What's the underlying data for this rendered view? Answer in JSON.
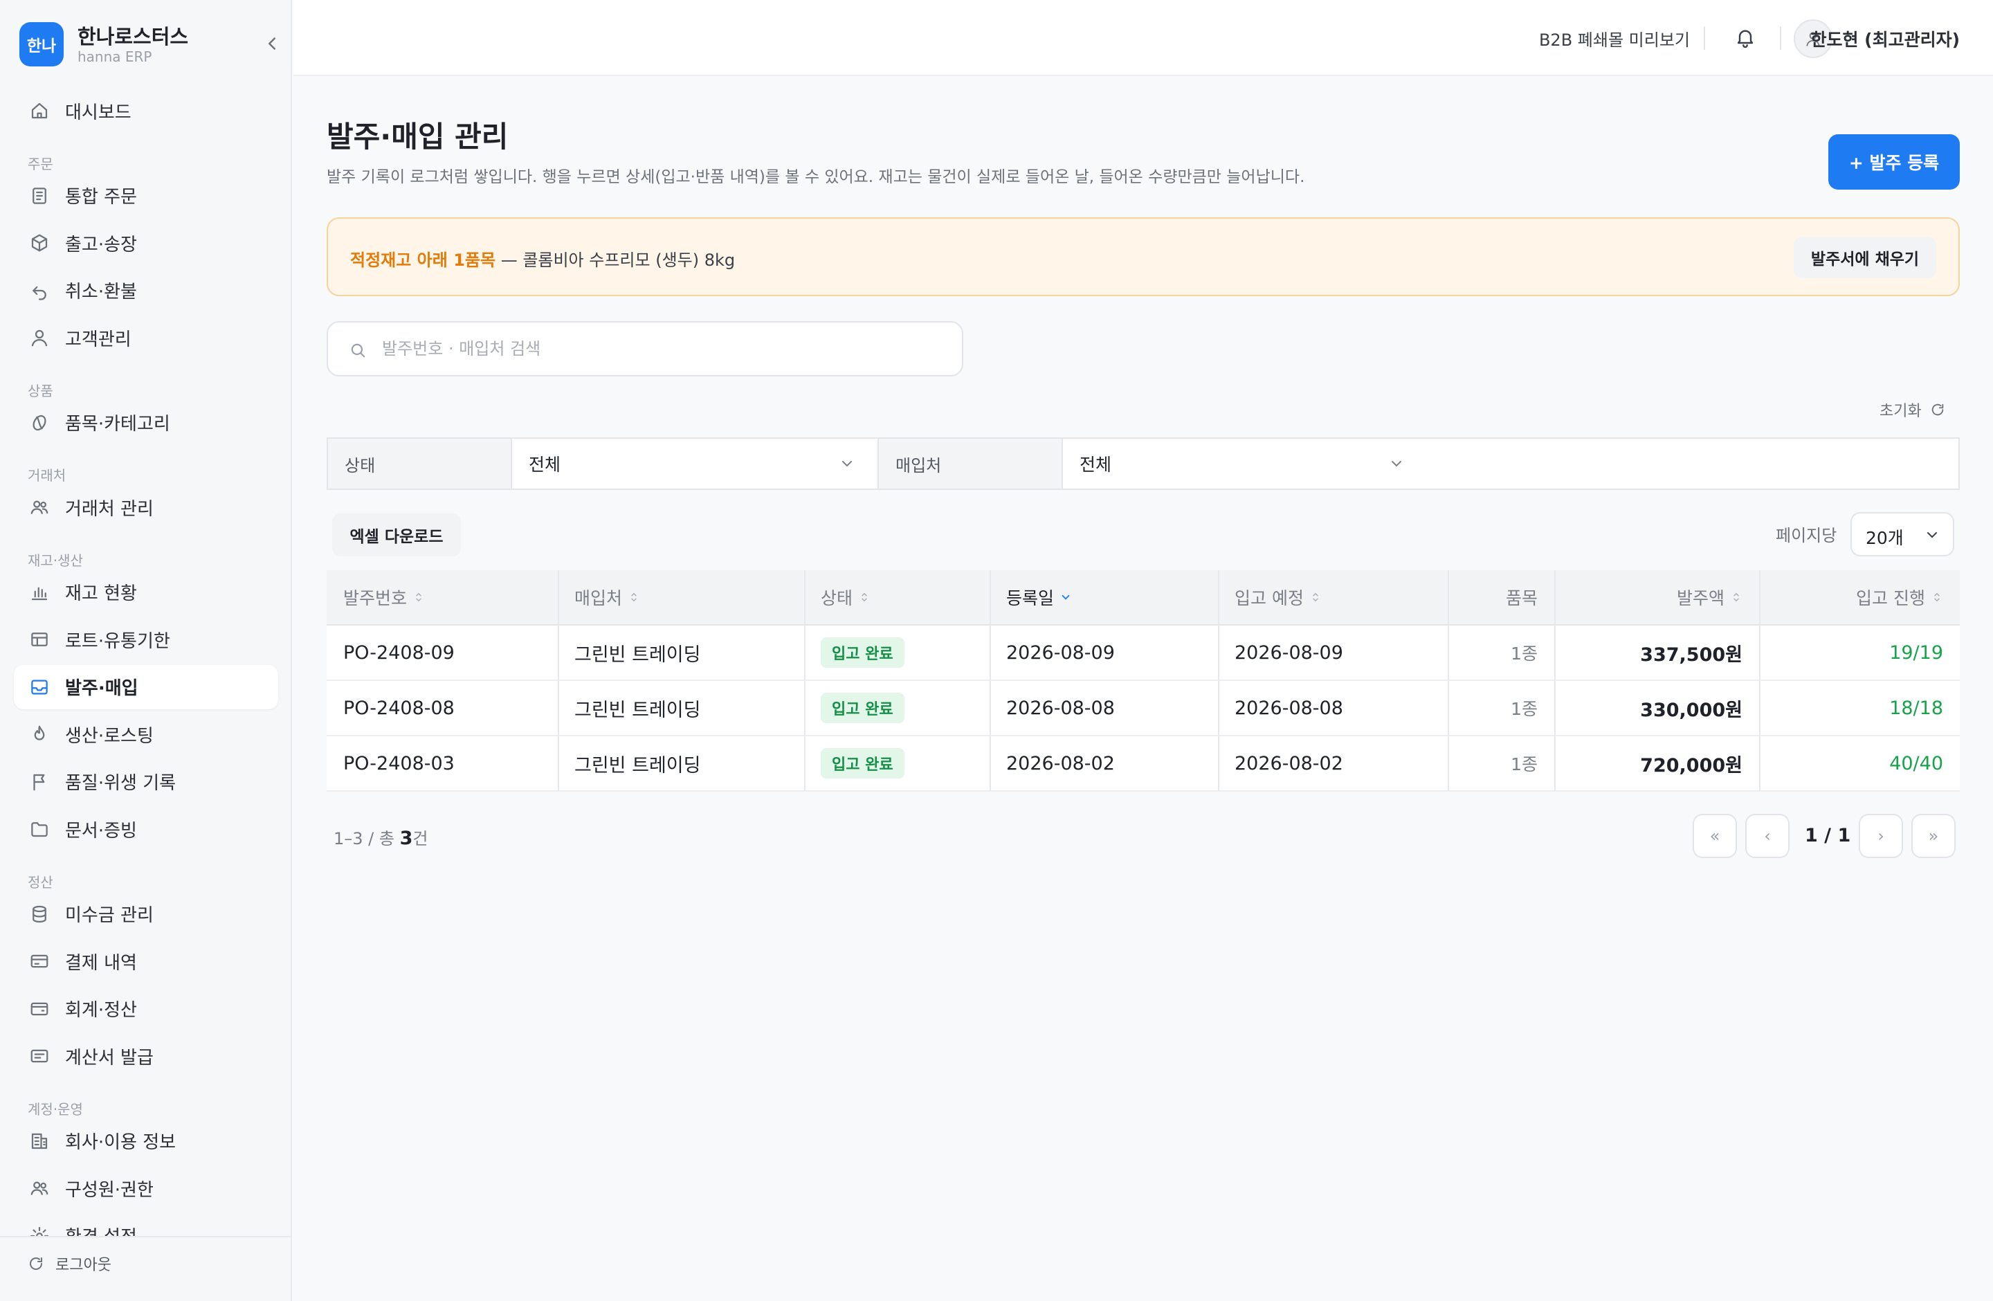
{
  "brand": {
    "logo_text": "한나",
    "name": "한나로스터스",
    "subtitle": "hanna ERP"
  },
  "sidebar": {
    "items": [
      {
        "type": "item",
        "label": "대시보드",
        "icon": "home-icon"
      },
      {
        "type": "group",
        "label": "주문"
      },
      {
        "type": "item",
        "label": "통합 주문",
        "icon": "document-icon"
      },
      {
        "type": "item",
        "label": "출고·송장",
        "icon": "box-icon"
      },
      {
        "type": "item",
        "label": "취소·환불",
        "icon": "undo-icon"
      },
      {
        "type": "item",
        "label": "고객관리",
        "icon": "user-icon"
      },
      {
        "type": "group",
        "label": "상품"
      },
      {
        "type": "item",
        "label": "품목·카테고리",
        "icon": "bean-icon"
      },
      {
        "type": "group",
        "label": "거래처"
      },
      {
        "type": "item",
        "label": "거래처 관리",
        "icon": "users-icon"
      },
      {
        "type": "group",
        "label": "재고·생산"
      },
      {
        "type": "item",
        "label": "재고 현황",
        "icon": "bar-chart-icon"
      },
      {
        "type": "item",
        "label": "로트·유통기한",
        "icon": "table-icon"
      },
      {
        "type": "item",
        "label": "발주·매입",
        "icon": "inbox-icon",
        "active": true
      },
      {
        "type": "item",
        "label": "생산·로스팅",
        "icon": "flame-icon"
      },
      {
        "type": "item",
        "label": "품질·위생 기록",
        "icon": "flag-icon"
      },
      {
        "type": "item",
        "label": "문서·증빙",
        "icon": "folder-icon"
      },
      {
        "type": "group",
        "label": "정산"
      },
      {
        "type": "item",
        "label": "미수금 관리",
        "icon": "database-icon"
      },
      {
        "type": "item",
        "label": "결제 내역",
        "icon": "card-icon"
      },
      {
        "type": "item",
        "label": "회계·정산",
        "icon": "wallet-icon"
      },
      {
        "type": "item",
        "label": "계산서 발급",
        "icon": "receipt-icon"
      },
      {
        "type": "group",
        "label": "계정·운영"
      },
      {
        "type": "item",
        "label": "회사·이용 정보",
        "icon": "building-icon"
      },
      {
        "type": "item",
        "label": "구성원·권한",
        "icon": "users-icon"
      },
      {
        "type": "item",
        "label": "환경 설정",
        "icon": "gear-icon"
      }
    ],
    "logout_label": "로그아웃"
  },
  "header": {
    "preview_label": "B2B 폐쇄몰 미리보기",
    "user_name": "한도현 (최고관리자)"
  },
  "page": {
    "title": "발주·매입 관리",
    "description": "발주 기록이 로그처럼 쌓입니다. 행을 누르면 상세(입고·반품 내역)를 볼 수 있어요. 재고는 물건이 실제로 들어온 날, 들어온 수량만큼만 늘어납니다.",
    "add_button": "+ 발주 등록"
  },
  "alert": {
    "strong": "적정재고 아래 1품목",
    "text": " — 콜롬비아 수프리모 (생두) 8kg",
    "button": "발주서에 채우기"
  },
  "search": {
    "placeholder": "발주번호 · 매입처 검색"
  },
  "filters": {
    "reset_label": "초기화",
    "status_label": "상태",
    "status_value": "전체",
    "vendor_label": "매입처",
    "vendor_value": "전체"
  },
  "toolbar": {
    "excel_label": "엑셀 다운로드",
    "per_page_label": "페이지당",
    "per_page_value": "20개"
  },
  "table": {
    "columns": [
      "발주번호",
      "매입처",
      "상태",
      "등록일",
      "입고 예정",
      "품목",
      "발주액",
      "입고 진행"
    ],
    "rows": [
      {
        "po": "PO-2408-09",
        "vendor": "그린빈 트레이딩",
        "status": "입고 완료",
        "registered": "2026-08-09",
        "expected": "2026-08-09",
        "items": "1종",
        "amount": "337,500원",
        "progress": "19/19"
      },
      {
        "po": "PO-2408-08",
        "vendor": "그린빈 트레이딩",
        "status": "입고 완료",
        "registered": "2026-08-08",
        "expected": "2026-08-08",
        "items": "1종",
        "amount": "330,000원",
        "progress": "18/18"
      },
      {
        "po": "PO-2408-03",
        "vendor": "그린빈 트레이딩",
        "status": "입고 완료",
        "registered": "2026-08-02",
        "expected": "2026-08-02",
        "items": "1종",
        "amount": "720,000원",
        "progress": "40/40"
      }
    ]
  },
  "pagination": {
    "range": "1–3 / 총 ",
    "total": "3",
    "unit": "건",
    "page_text": "1 / 1",
    "first": "«",
    "prev": "‹",
    "next": "›",
    "last": "»"
  },
  "colors": {
    "primary": "#1f7bf2",
    "alert_strong": "#e47b08",
    "success": "#17a34a",
    "badge_bg": "#e3f6ea"
  }
}
